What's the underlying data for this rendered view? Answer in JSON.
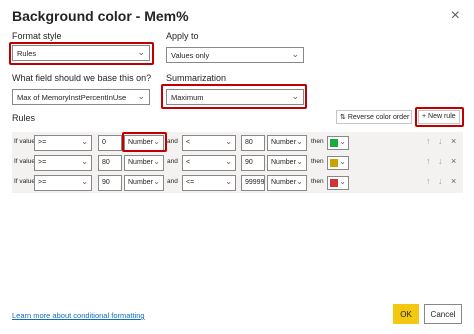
{
  "dialog": {
    "title": "Background color - Mem%"
  },
  "format_style": {
    "label": "Format style",
    "value": "Rules"
  },
  "apply_to": {
    "label": "Apply to",
    "value": "Values only"
  },
  "base_field": {
    "label": "What field should we base this on?",
    "value": "Max of MemoryInstPercentInUse"
  },
  "summarization": {
    "label": "Summarization",
    "value": "Maximum"
  },
  "rules": {
    "label": "Rules",
    "reverse_label": "Reverse color order",
    "new_rule_label": "+ New rule",
    "items": [
      {
        "if_label": "If value",
        "op1": ">=",
        "value1": "0",
        "type1": "Number",
        "and_label": "and",
        "op2": "<",
        "value2": "80",
        "type2": "Number",
        "then_label": "then",
        "color": "#1aab40"
      },
      {
        "if_label": "If value",
        "op1": ">=",
        "value1": "80",
        "type1": "Number",
        "and_label": "and",
        "op2": "<",
        "value2": "90",
        "type2": "Number",
        "then_label": "then",
        "color": "#c8a400"
      },
      {
        "if_label": "If value",
        "op1": ">=",
        "value1": "90",
        "type1": "Number",
        "and_label": "and",
        "op2": "<=",
        "value2": "99999",
        "type2": "Number",
        "then_label": "then",
        "color": "#d13438"
      }
    ]
  },
  "footer": {
    "link": "Learn more about conditional formatting",
    "ok": "OK",
    "cancel": "Cancel"
  }
}
